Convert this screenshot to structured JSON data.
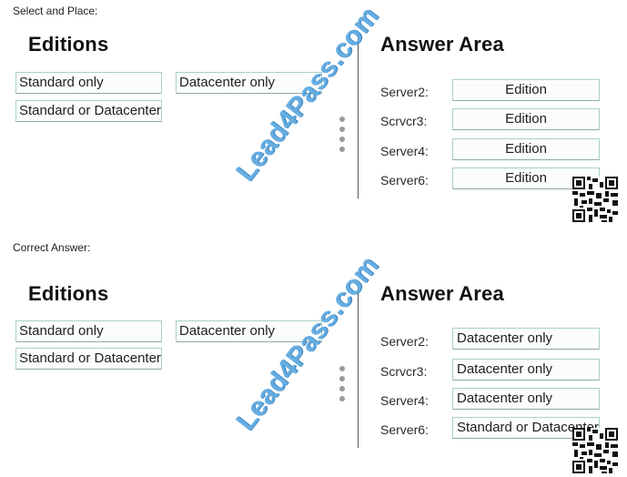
{
  "select_section": {
    "caption": "Select and Place:",
    "editions": {
      "heading": "Editions",
      "options": [
        "Standard only",
        "Datacenter only",
        "Standard or Datacenter"
      ]
    },
    "answer_area": {
      "heading": "Answer Area",
      "rows": [
        {
          "label": "Server2:",
          "value": "Edition"
        },
        {
          "label": "Scrvcr3:",
          "value": "Edition"
        },
        {
          "label": "Server4:",
          "value": "Edition"
        },
        {
          "label": "Server6:",
          "value": "Edition"
        }
      ]
    }
  },
  "answer_section": {
    "caption": "Correct Answer:",
    "editions": {
      "heading": "Editions",
      "options": [
        "Standard only",
        "Datacenter only",
        "Standard or Datacenter"
      ]
    },
    "answer_area": {
      "heading": "Answer Area",
      "rows": [
        {
          "label": "Server2:",
          "value": "Datacenter only"
        },
        {
          "label": "Scrvcr3:",
          "value": "Datacenter only"
        },
        {
          "label": "Server4:",
          "value": "Datacenter only"
        },
        {
          "label": "Server6:",
          "value": "Standard or Datacenter"
        }
      ]
    }
  },
  "watermark": "Lead4Pass.com",
  "icons": {
    "drag_handle": "drag-dots-icon",
    "qr_code": "qr-code-icon"
  },
  "colors": {
    "chip_border": "#a9cfcc",
    "watermark": "#5aa7e0"
  }
}
